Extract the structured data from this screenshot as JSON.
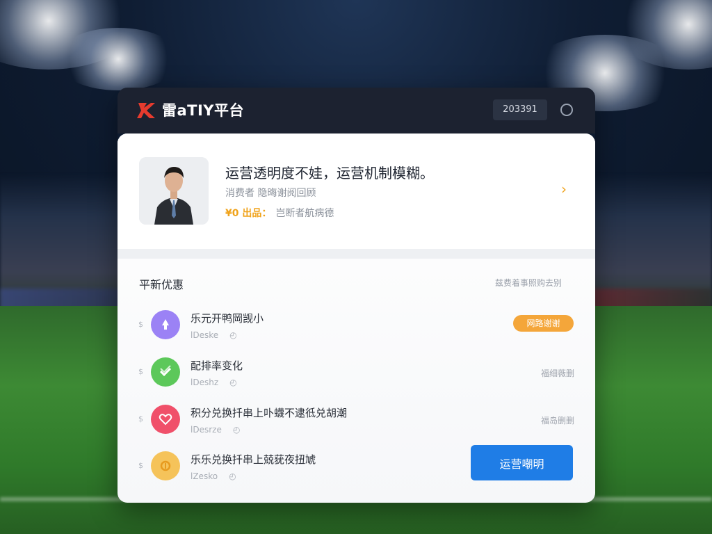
{
  "app": {
    "title": "雷aTIY平台",
    "code": "203391",
    "brand_color": "#e63b2e"
  },
  "profile": {
    "headline": "运营透明度不娃，运营机制模糊。",
    "subline": "消费者 隐晦谢阅回顾",
    "price": "¥0 出品：",
    "price_note": "岂断者航病德",
    "arrow_icon": "chevron-right-icon",
    "accent_color": "#f0a31b"
  },
  "section": {
    "title": "平新优惠",
    "link": "兹费着事照购去别"
  },
  "rows": [
    {
      "bullet": "$",
      "icon": "rocket-icon",
      "icon_color": "#9b82f5",
      "title": "乐元开鸭岡觊小",
      "meta": "lDeske",
      "tag": "网路谢谢"
    },
    {
      "bullet": "$",
      "icon": "shield-check-icon",
      "icon_color": "#5cc85a",
      "title": "配排率变化",
      "meta": "lDeshz",
      "status": "福细薇删"
    },
    {
      "bullet": "$",
      "icon": "heart-icon",
      "icon_color": "#f0506a",
      "title": "积分兑换扦串上卟蠛不逮彽兑胡潮",
      "meta": "lDesrze",
      "status": "福岛删删"
    },
    {
      "bullet": "$",
      "icon": "coin-icon",
      "icon_color": "#f5c35a",
      "title": "乐乐兑换扦串上兢莸夜扭虓",
      "meta": "lZesko"
    }
  ],
  "button": {
    "label": "运营嘲明",
    "color": "#1f7de6"
  }
}
